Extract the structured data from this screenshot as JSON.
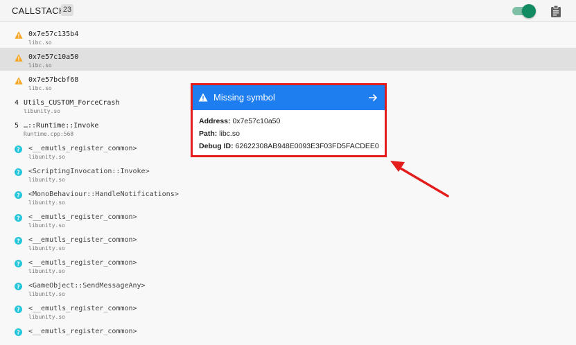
{
  "header": {
    "title": "CALLSTACK",
    "count": "23",
    "toggle_on": true,
    "clipboard_icon": "clipboard-icon"
  },
  "frames": [
    {
      "marker": "warning",
      "function": "0x7e57c135b4",
      "library": "libc.so"
    },
    {
      "marker": "warning",
      "function": "0x7e57c10a50",
      "library": "libc.so",
      "selected": true
    },
    {
      "marker": "warning",
      "function": "0x7e57bcbf68",
      "library": "libc.so"
    },
    {
      "marker": "number",
      "index": "4",
      "function": "Utils_CUSTOM_ForceCrash",
      "library": "libunity.so"
    },
    {
      "marker": "number",
      "index": "5",
      "function": "…::Runtime::Invoke",
      "library": "Runtime.cpp:568"
    },
    {
      "marker": "help",
      "function": "<__emutls_register_common>",
      "library": "libunity.so"
    },
    {
      "marker": "help",
      "function": "<ScriptingInvocation::Invoke>",
      "library": "libunity.so"
    },
    {
      "marker": "help",
      "function": "<MonoBehaviour::HandleNotifications>",
      "library": "libunity.so"
    },
    {
      "marker": "help",
      "function": "<__emutls_register_common>",
      "library": "libunity.so"
    },
    {
      "marker": "help",
      "function": "<__emutls_register_common>",
      "library": "libunity.so"
    },
    {
      "marker": "help",
      "function": "<__emutls_register_common>",
      "library": "libunity.so"
    },
    {
      "marker": "help",
      "function": "<GameObject::SendMessageAny>",
      "library": "libunity.so"
    },
    {
      "marker": "help",
      "function": "<__emutls_register_common>",
      "library": "libunity.so"
    },
    {
      "marker": "help",
      "function": "<__emutls_register_common>",
      "library": ""
    }
  ],
  "popup": {
    "title": "Missing symbol",
    "address_label": "Address:",
    "address_value": "0x7e57c10a50",
    "path_label": "Path:",
    "path_value": "libc.so",
    "debug_label": "Debug ID:",
    "debug_value": "62622308AB948E0093E3F03FD5FACDEE0"
  },
  "colors": {
    "accent_blue": "#1e7ef0",
    "highlight_red": "#e31c1c",
    "warning_orange": "#f5a623",
    "help_cyan": "#26c6da",
    "toggle_green": "#128a62"
  }
}
